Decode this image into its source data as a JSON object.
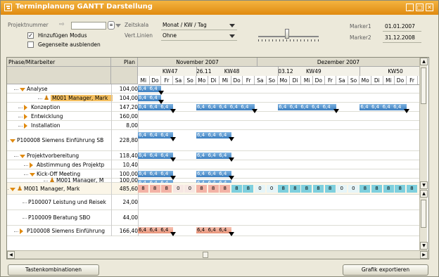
{
  "window": {
    "title": "Terminplanung GANTT Darstellung"
  },
  "controls": {
    "projektnummer_label": "Projektnummer",
    "hinzufuegen_label": "Hinzufügen Modus",
    "gegenseite_label": "Gegenseite ausblenden",
    "zeitskala_label": "Zeitskala",
    "zeitskala_value": "Monat / KW / Tag",
    "vertlinien_label": "Vert.Linien",
    "vertlinien_value": "Ohne",
    "marker1_label": "Marker1",
    "marker1_value": "01.01.2007",
    "marker2_label": "Marker2",
    "marker2_value": "31.12.2008",
    "hinzufuegen_checked": true,
    "gegenseite_checked": false
  },
  "grid": {
    "col_phase": "Phase/Mitarbeiter",
    "col_plan": "Plan",
    "months": [
      "November 2007",
      "Dezember 2007"
    ],
    "weeks": [
      "KW47",
      "26.11",
      "KW48",
      "03.12",
      "KW49",
      "KW50"
    ],
    "days": [
      "Mi",
      "Do",
      "Fr",
      "Sa",
      "So",
      "Mo",
      "Di",
      "Mi",
      "Do",
      "Fr",
      "Sa",
      "So",
      "Mo",
      "Di",
      "Mi",
      "Do",
      "Fr",
      "Sa",
      "So",
      "Mo",
      "Di",
      "Mi",
      "Do",
      "Fr"
    ],
    "rows": [
      {
        "name": "Analyse",
        "plan": "104,00",
        "bars": [
          [
            "6,4",
            "6,4"
          ]
        ]
      },
      {
        "name": "M001 Manager, Mark",
        "plan": "104,00",
        "bars": [
          [
            "6,4",
            "6,4"
          ]
        ]
      },
      {
        "name": "Konzeption",
        "plan": "147,20",
        "bars": [
          [
            "6,4",
            "6,4",
            "6,4"
          ],
          [
            "6,4",
            "6,4",
            "6,4",
            "6,4",
            "6,4"
          ],
          [
            "6,4",
            "6,4",
            "6,4",
            "6,4",
            "6,4"
          ],
          [
            "6,4",
            "6,4",
            "6,4",
            "6,4"
          ]
        ]
      },
      {
        "name": "Entwicklung",
        "plan": "160,00"
      },
      {
        "name": "Installation",
        "plan": "8,00"
      },
      {
        "name": "P100008  Siemens Einführung SB",
        "plan": "228,80",
        "bars": [
          [
            "6,4",
            "6,4",
            "6,4"
          ],
          [
            "6,4",
            "6,4",
            "6,4"
          ]
        ]
      },
      {
        "name": "Projektvorbereitung",
        "plan": "118,40",
        "bars": [
          [
            "6,4",
            "6,4",
            "6,4"
          ],
          [
            "6,4",
            "6,4",
            "6,4"
          ]
        ]
      },
      {
        "name": "Abstimmung des Projektp",
        "plan": "10,40"
      },
      {
        "name": "Kick-Off Meeting",
        "plan": "100,00",
        "bars": [
          [
            "6,4",
            "6,4",
            "6,4"
          ],
          [
            "6,4",
            "6,4",
            "6,4"
          ]
        ]
      },
      {
        "name": "M001 Manager, M",
        "plan": "100,00",
        "bars": [
          [
            "6,4",
            "6,4",
            "6,4"
          ],
          [
            "6,4",
            "6,4",
            "6,4"
          ]
        ]
      },
      {
        "name": "M001 Manager, Mark",
        "plan": "485,60",
        "hours": [
          "8",
          "8",
          "8",
          "0",
          "0",
          "8",
          "8",
          "8",
          "8",
          "8",
          "0",
          "0",
          "8",
          "8",
          "8",
          "8",
          "8",
          "0",
          "0",
          "8",
          "8",
          "8",
          "8",
          "8"
        ]
      },
      {
        "name": "P100007  Leistung und Reisek",
        "plan": "24,00"
      },
      {
        "name": "P100009  Beratung SBO",
        "plan": "44,00"
      },
      {
        "name": "P100008  Siemens Einführung",
        "plan": "166,40",
        "bars": [
          [
            "6,4",
            "6,4",
            "6,4"
          ],
          [
            "6,4",
            "6,4",
            "6,4"
          ]
        ]
      }
    ]
  },
  "buttons": {
    "shortcuts": "Tastenkombinationen",
    "export": "Grafik exportieren"
  },
  "colors": {
    "titlebar": "#e08a10",
    "bluebar": "#3c7fc0",
    "pinkbar": "#e89378",
    "selected": "#f5c060"
  }
}
